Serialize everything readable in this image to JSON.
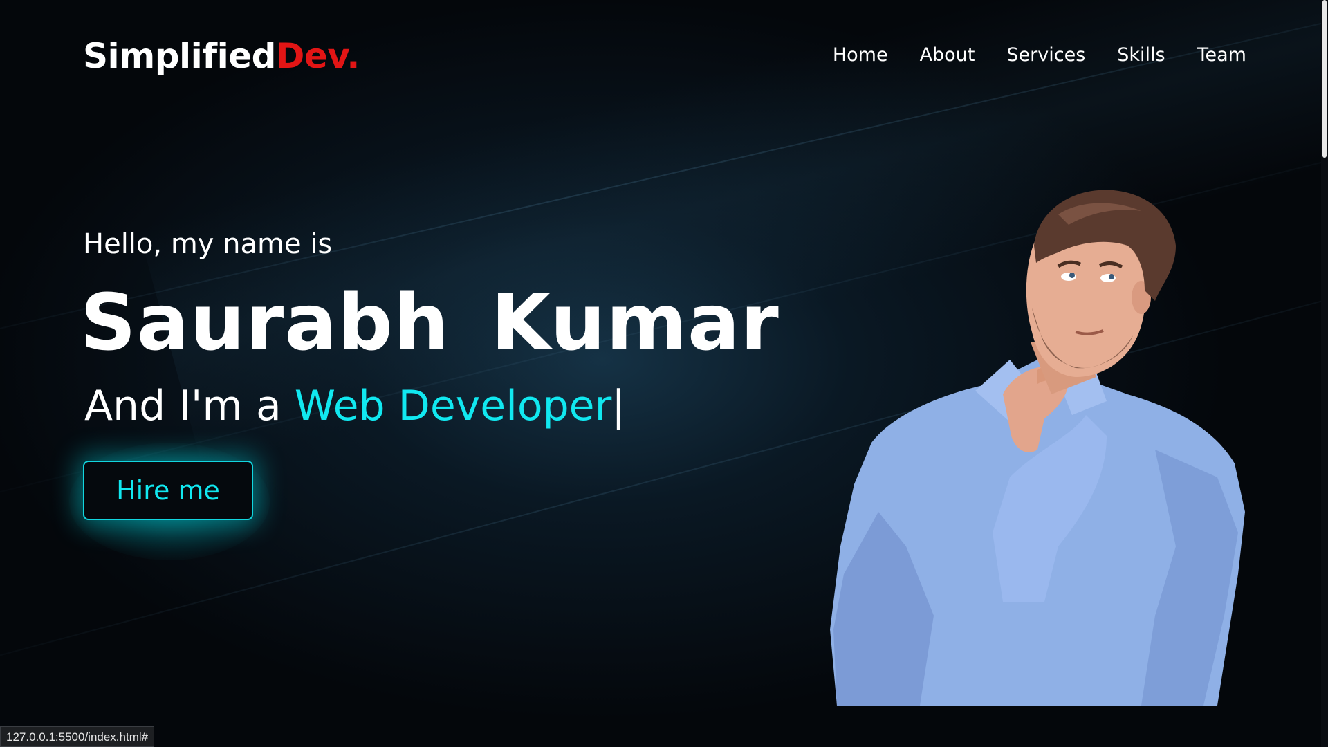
{
  "header": {
    "logo_main": "Simplified",
    "logo_accent": "Dev.",
    "nav": [
      {
        "label": "Home"
      },
      {
        "label": "About"
      },
      {
        "label": "Services"
      },
      {
        "label": "Skills"
      },
      {
        "label": "Team"
      }
    ]
  },
  "hero": {
    "greeting": "Hello, my name is",
    "name": "Saurabh Kumar",
    "role_prefix": "And I'm a ",
    "role": "Web Developer",
    "cursor": "|",
    "hire_label": "Hire me"
  },
  "status_bar": {
    "url": "127.0.0.1:5500/index.html#"
  },
  "colors": {
    "background": "#04070b",
    "accent_cyan": "#11e8f0",
    "logo_red": "#e21515",
    "text": "#ffffff"
  }
}
